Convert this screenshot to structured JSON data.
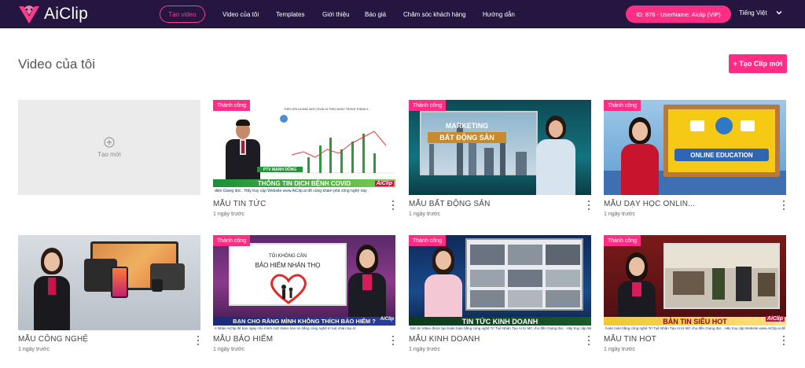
{
  "nav": {
    "logo_text": "AiClip",
    "create_video": "Tạo video",
    "menu": [
      "Video của tôi",
      "Templates",
      "Giới thiệu",
      "Báo giá",
      "Chăm sóc khách hàng",
      "Hướng dẫn"
    ],
    "user": "ID: 876 - UserName: Aiclip (VIP)",
    "language": "Tiếng Việt"
  },
  "header": {
    "title": "Video của tôi",
    "new_clip_button": "+ Tạo Clip mới"
  },
  "create_card": {
    "label": "Tạo mới"
  },
  "cards": [
    {
      "title": "MẪU TIN TỨC",
      "date": "1 ngày trước",
      "status": "Thành công",
      "thumb": {
        "headline": "THÔNG TIN DỊCH BỆNH COVID",
        "name_tag": "PTV MẠNH DŨNG",
        "ticker": "điện Giang dọc . Hãy truy cập Website www.AiClip.ai để cùng khám phá công nghệ này",
        "chart_title": "THEO DÕI CA MẮC MỚI COVID-19 THEO NGÀY TRONG THÁNG 9 ..."
      }
    },
    {
      "title": "MẪU BẤT ĐỘNG SẢN",
      "date": "1 ngày trước",
      "status": "Thành công",
      "thumb": {
        "line1": "MARKETING",
        "line2": "BẤT ĐỘNG SẢN"
      }
    },
    {
      "title": "MẪU DẠY HỌC ONLIN...",
      "date": "1 ngày trước",
      "status": "Thành công",
      "thumb": {
        "board_text": "ONLINE EDUCATION"
      }
    },
    {
      "title": "MẪU CÔNG NGHỆ",
      "date": "1 ngày trước",
      "status": "",
      "thumb": {}
    },
    {
      "title": "MẪU BẢO HIỂM",
      "date": "1 ngày trước",
      "status": "Thành công",
      "thumb": {
        "line1": "TÔI KHÔNG CẦN",
        "line2": "BẢO HIỂM NHÂN THỌ",
        "headline": "BẠN CHO RẰNG MÌNH KHÔNG THÍCH BẢO HIỂM ?",
        "ticker": "n Nhận AiClip để bạn ngay cho mình một Video hàn tin bằng công nghệ trí tuệ nhân tạo AI"
      }
    },
    {
      "title": "MẪU KINH DOANH",
      "date": "1 ngày trước",
      "status": "Thành công",
      "thumb": {
        "headline": "TIN TỨC KINH DOANH",
        "ticker": "bản tin Video được tạo hoàn toàn bằng công nghệ Trí Tuệ Nhân Tạo AI từ MC cho đến Giọng đọc . Hãy truy cập Website"
      }
    },
    {
      "title": "MẪU TIN HOT",
      "date": "1 ngày trước",
      "status": "Thành công",
      "thumb": {
        "headline": "BẢN TIN SIÊU HOT",
        "ticker": "hoàn toàn bằng công nghệ Trí Tuệ Nhân Tạo AI từ MC cho đến Giọng đọc . Hãy truy cập Website www.AiClip.ai để cùng"
      }
    }
  ],
  "brand_watermark": "AiClip",
  "colors": {
    "nav_bg": "#241640",
    "accent": "#ff2d84"
  }
}
